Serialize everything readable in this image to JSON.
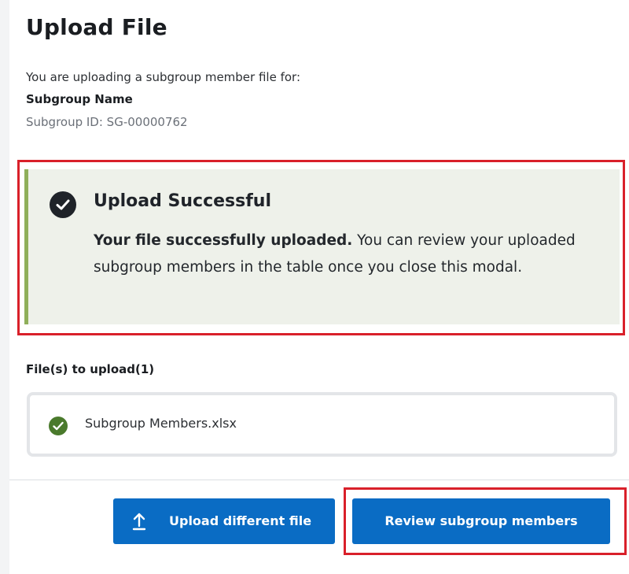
{
  "modal": {
    "title": "Upload File",
    "intro": "You are uploading a subgroup member file for:",
    "subgroup_name": "Subgroup Name",
    "subgroup_id": "Subgroup ID: SG-00000762"
  },
  "alert": {
    "icon": "check-circle-icon",
    "heading": "Upload Successful",
    "body_bold": "Your file successfully uploaded.",
    "body_rest": " You can review your uploaded subgroup members in the table once you close this modal.",
    "accent_color": "#8faf5a",
    "background_color": "#eef1ea"
  },
  "files": {
    "label": "File(s) to upload(1)",
    "items": [
      {
        "name": "Subgroup Members.xlsx",
        "status_icon": "success-check-icon",
        "status_color": "#4a7a2c"
      }
    ]
  },
  "footer": {
    "upload_button_label": "Upload different file",
    "upload_button_icon": "upload-arrow-icon",
    "review_button_label": "Review subgroup members",
    "button_color": "#0a6cc4"
  },
  "highlight_color": "#d9202a"
}
